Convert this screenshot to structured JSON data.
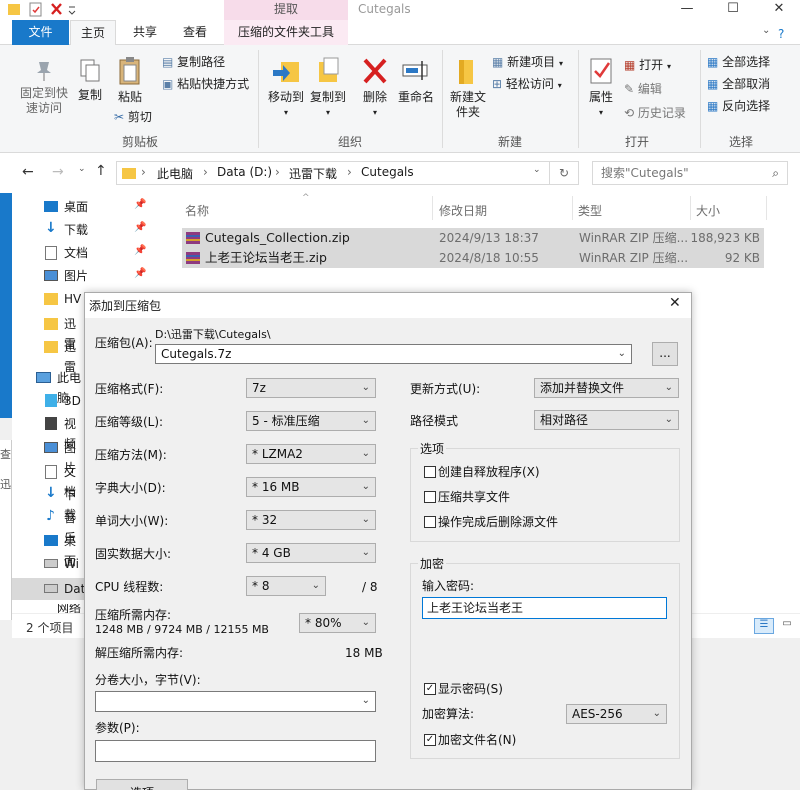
{
  "window": {
    "title": "Cutegals",
    "context_tab": "提取",
    "min": "—",
    "max": "☐",
    "close": "✕"
  },
  "ribbon": {
    "tabs": [
      "文件",
      "主页",
      "共享",
      "查看",
      "压缩的文件夹工具"
    ],
    "clipboard": {
      "pin_quick": "固定到快速访问",
      "copy": "复制",
      "paste": "粘贴",
      "copy_path": "复制路径",
      "paste_shortcut": "粘贴快捷方式",
      "cut": "剪切",
      "group": "剪贴板"
    },
    "organize": {
      "move_to": "移动到",
      "copy_to": "复制到",
      "delete": "删除",
      "rename": "重命名",
      "group": "组织"
    },
    "new": {
      "new_folder": "新建文件夹",
      "new_item": "新建项目",
      "easy_access": "轻松访问",
      "group": "新建"
    },
    "open": {
      "properties": "属性",
      "open": "打开",
      "edit": "编辑",
      "history": "历史记录",
      "group": "打开"
    },
    "select": {
      "select_all": "全部选择",
      "select_none": "全部取消",
      "invert": "反向选择",
      "group": "选择"
    }
  },
  "address": {
    "path": [
      "此电脑",
      "Data (D:)",
      "迅雷下载",
      "Cutegals"
    ],
    "search_placeholder": "搜索\"Cutegals\""
  },
  "nav": {
    "quick": [
      {
        "label": "桌面",
        "pinned": true
      },
      {
        "label": "下载",
        "pinned": true
      },
      {
        "label": "文档",
        "pinned": true
      },
      {
        "label": "图片",
        "pinned": true
      },
      {
        "label": "HV"
      },
      {
        "label": "迅雷"
      },
      {
        "label": "迅雷"
      }
    ],
    "this_pc": "此电脑",
    "pc_items": [
      "3D",
      "视频",
      "图片",
      "文档",
      "下载",
      "音乐",
      "桌面",
      "Wi",
      "Dat"
    ],
    "network": "网络"
  },
  "columns": [
    "名称",
    "修改日期",
    "类型",
    "大小"
  ],
  "files": [
    {
      "name": "Cutegals_Collection.zip",
      "date": "2024/9/13 18:37",
      "type": "WinRAR ZIP 压缩...",
      "size": "188,923 KB"
    },
    {
      "name": "上老王论坛当老王.zip",
      "date": "2024/8/18 10:55",
      "type": "WinRAR ZIP 压缩...",
      "size": "92 KB"
    }
  ],
  "status": {
    "count": "2 个项目"
  },
  "left_fragments": [
    "查看",
    "迅"
  ],
  "dialog": {
    "title": "添加到压缩包",
    "archive_label": "压缩包(A):",
    "archive_dir": "D:\\迅雷下载\\Cutegals\\",
    "archive_name": "Cutegals.7z",
    "browse": "...",
    "format_label": "压缩格式(F):",
    "format": "7z",
    "level_label": "压缩等级(L):",
    "level": "5 - 标准压缩",
    "method_label": "压缩方法(M):",
    "method": "* LZMA2",
    "dict_label": "字典大小(D):",
    "dict": "* 16 MB",
    "word_label": "单词大小(W):",
    "word": "* 32",
    "solid_label": "固实数据大小:",
    "solid": "* 4 GB",
    "threads_label": "CPU 线程数:",
    "threads": "* 8",
    "threads_max": "/ 8",
    "mem_c_label": "压缩所需内存:",
    "mem_c_value": "1248 MB / 9724 MB / 12155 MB",
    "mem_pct": "* 80%",
    "mem_d_label": "解压缩所需内存:",
    "mem_d_value": "18 MB",
    "split_label": "分卷大小，字节(V):",
    "params_label": "参数(P):",
    "options_btn": "选项",
    "update_label": "更新方式(U):",
    "update": "添加并替换文件",
    "pathmode_label": "路径模式",
    "pathmode": "相对路径",
    "options_group": "选项",
    "opt_sfx": "创建自释放程序(X)",
    "opt_shared": "压缩共享文件",
    "opt_delete": "操作完成后删除源文件",
    "encrypt_group": "加密",
    "pwd_label": "输入密码:",
    "pwd": "上老王论坛当老王",
    "show_pwd": "显示密码(S)",
    "enc_method_label": "加密算法:",
    "enc_method": "AES-256",
    "enc_names": "加密文件名(N)",
    "close": "✕"
  }
}
